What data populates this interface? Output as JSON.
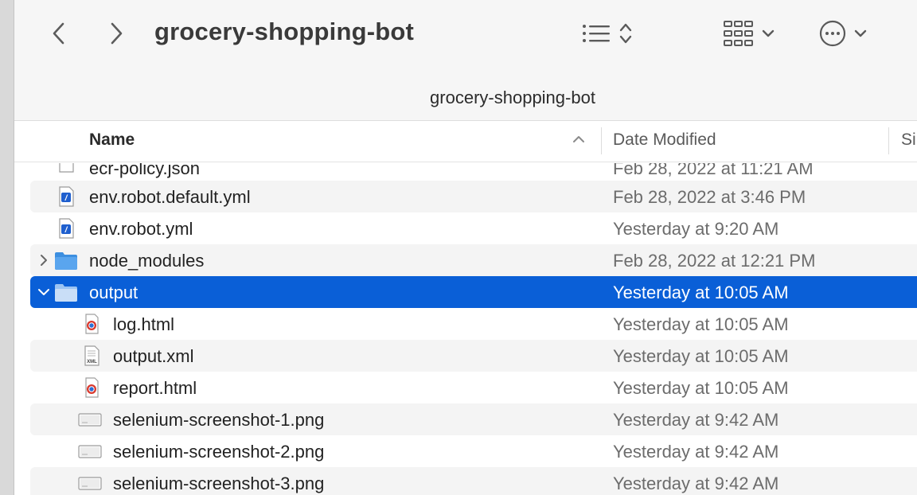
{
  "window": {
    "title": "grocery-shopping-bot",
    "path_title": "grocery-shopping-bot"
  },
  "toolbar": {
    "back_icon": "chevron-left-icon",
    "forward_icon": "chevron-right-icon",
    "view_options_icon": "list-sort-icon",
    "group_icon": "grid-icon",
    "more_icon": "ellipsis-circle-icon"
  },
  "columns": {
    "name": "Name",
    "date": "Date Modified",
    "size": "Si"
  },
  "files": [
    {
      "name": "ecr-policy.json",
      "date": "Feb 28, 2022 at 11:21 AM",
      "icon": "json-file-icon"
    },
    {
      "name": "env.robot.default.yml",
      "date": "Feb 28, 2022 at 3:46 PM",
      "icon": "yml-file-icon"
    },
    {
      "name": "env.robot.yml",
      "date": "Yesterday at 9:20 AM",
      "icon": "yml-file-icon"
    },
    {
      "name": "node_modules",
      "date": "Feb 28, 2022 at 12:21 PM",
      "icon": "folder-icon"
    },
    {
      "name": "output",
      "date": "Yesterday at 10:05 AM",
      "icon": "folder-icon"
    },
    {
      "name": "log.html",
      "date": "Yesterday at 10:05 AM",
      "icon": "html-file-icon"
    },
    {
      "name": "output.xml",
      "date": "Yesterday at 10:05 AM",
      "icon": "xml-file-icon"
    },
    {
      "name": "report.html",
      "date": "Yesterday at 10:05 AM",
      "icon": "html-file-icon"
    },
    {
      "name": "selenium-screenshot-1.png",
      "date": "Yesterday at 9:42 AM",
      "icon": "png-file-icon"
    },
    {
      "name": "selenium-screenshot-2.png",
      "date": "Yesterday at 9:42 AM",
      "icon": "png-file-icon"
    },
    {
      "name": "selenium-screenshot-3.png",
      "date": "Yesterday at 9:42 AM",
      "icon": "png-file-icon"
    }
  ],
  "selection_color": "#0a5fd7",
  "folder_color": "#3d8fe0"
}
